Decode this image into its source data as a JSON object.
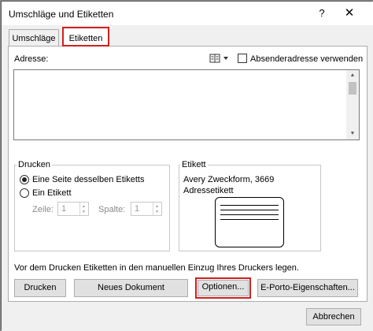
{
  "window": {
    "title": "Umschläge und Etiketten",
    "help_label": "?",
    "close_label": "✕"
  },
  "tabs": [
    {
      "label": "Umschläge",
      "active": false
    },
    {
      "label": "Etiketten",
      "active": true
    }
  ],
  "address": {
    "label": "Adresse:",
    "value": "",
    "sender_checkbox_label": "Absenderadresse verwenden",
    "sender_checked": false
  },
  "print_group": {
    "title": "Drucken",
    "option_full_page": "Eine Seite desselben Etiketts",
    "option_single": "Ein Etikett",
    "selected": "option_full_page",
    "row_label": "Zeile:",
    "row_value": "1",
    "column_label": "Spalte:",
    "column_value": "1"
  },
  "label_group": {
    "title": "Etikett",
    "vendor_line": "Avery Zweckform, 3669",
    "type_line": "Adressetikett"
  },
  "note": "Vor dem Drucken Etiketten in den manuellen Einzug Ihres Druckers legen.",
  "buttons": {
    "print": "Drucken",
    "new_document": "Neues Dokument",
    "options": "Optionen...",
    "eporto": "E-Porto-Eigenschaften...",
    "cancel": "Abbrechen"
  },
  "colors": {
    "highlight": "#d0201e",
    "dialog_bg": "#f0f0f0"
  }
}
